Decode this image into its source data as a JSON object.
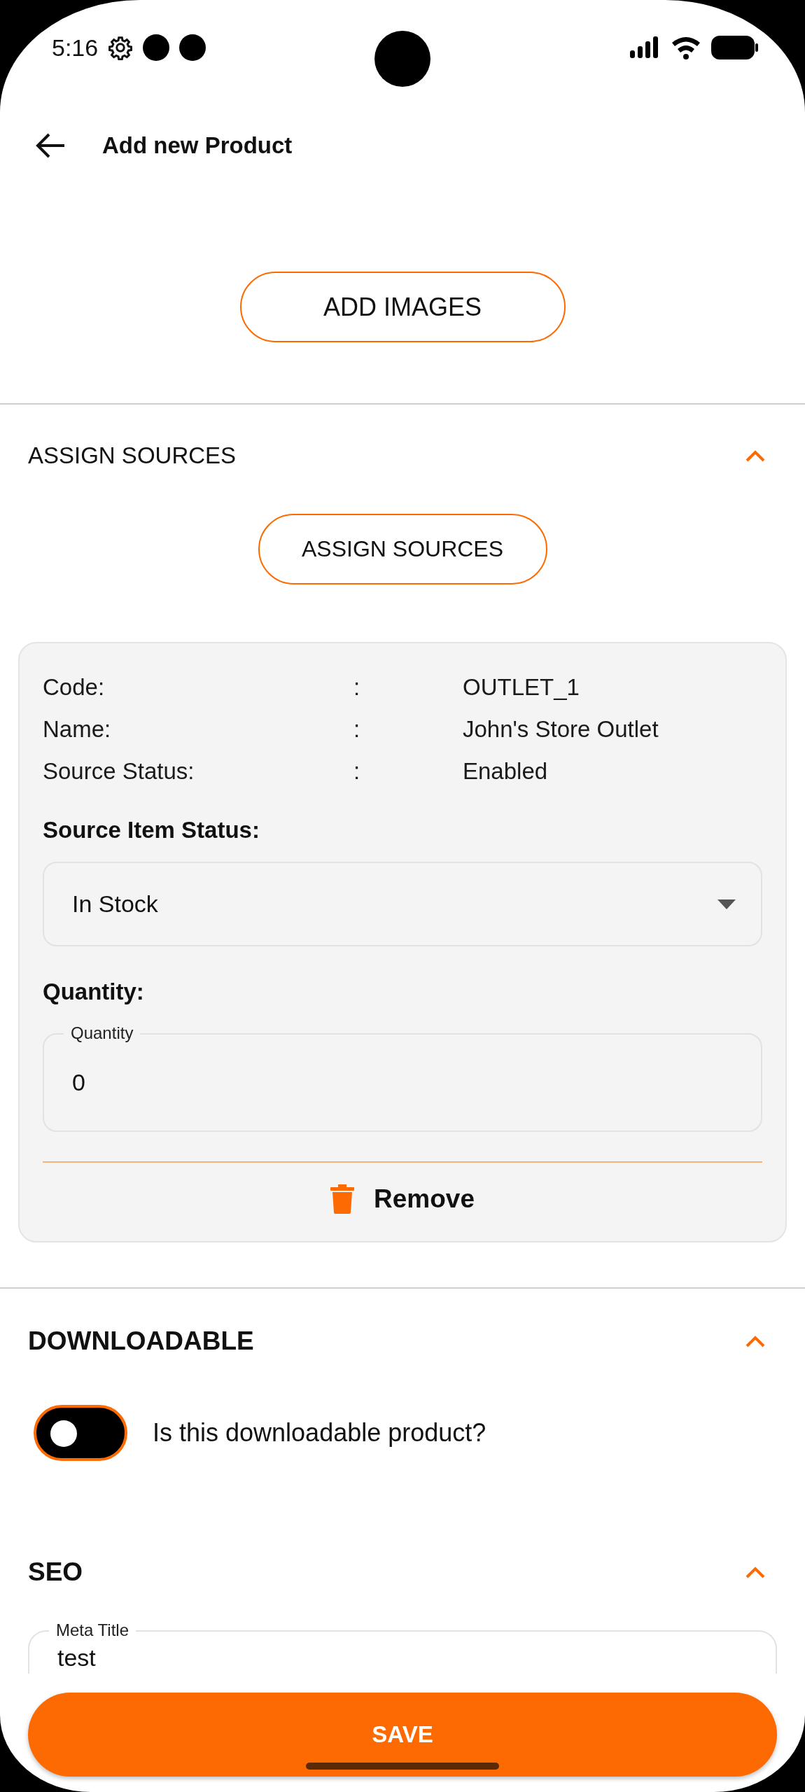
{
  "status_bar": {
    "time": "5:16"
  },
  "header": {
    "title": "Add new Product"
  },
  "add_images_button": "ADD IMAGES",
  "sections": [
    {
      "kind": "sources",
      "title": "ASSIGN SOURCES",
      "expanded": true,
      "button": "ASSIGN SOURCES",
      "source": {
        "rows": [
          {
            "label": "Code:",
            "separator": ":",
            "value": "OUTLET_1"
          },
          {
            "label": "Name:",
            "separator": ":",
            "value": "John's Store Outlet"
          },
          {
            "label": "Source Status:",
            "separator": ":",
            "value": "Enabled"
          }
        ],
        "item_status": {
          "heading": "Source Item Status:",
          "value": "In Stock"
        },
        "quantity": {
          "heading": "Quantity:",
          "label": "Quantity",
          "value": "0"
        },
        "remove": "Remove"
      }
    },
    {
      "kind": "downloadable",
      "title": "DOWNLOADABLE",
      "expanded": true,
      "toggle": {
        "label": "Is this downloadable product?",
        "on": false
      }
    },
    {
      "kind": "seo",
      "title": "SEO",
      "expanded": true,
      "fields": [
        {
          "label": "Meta Title",
          "value": "test"
        }
      ]
    }
  ],
  "save_button": "SAVE"
}
